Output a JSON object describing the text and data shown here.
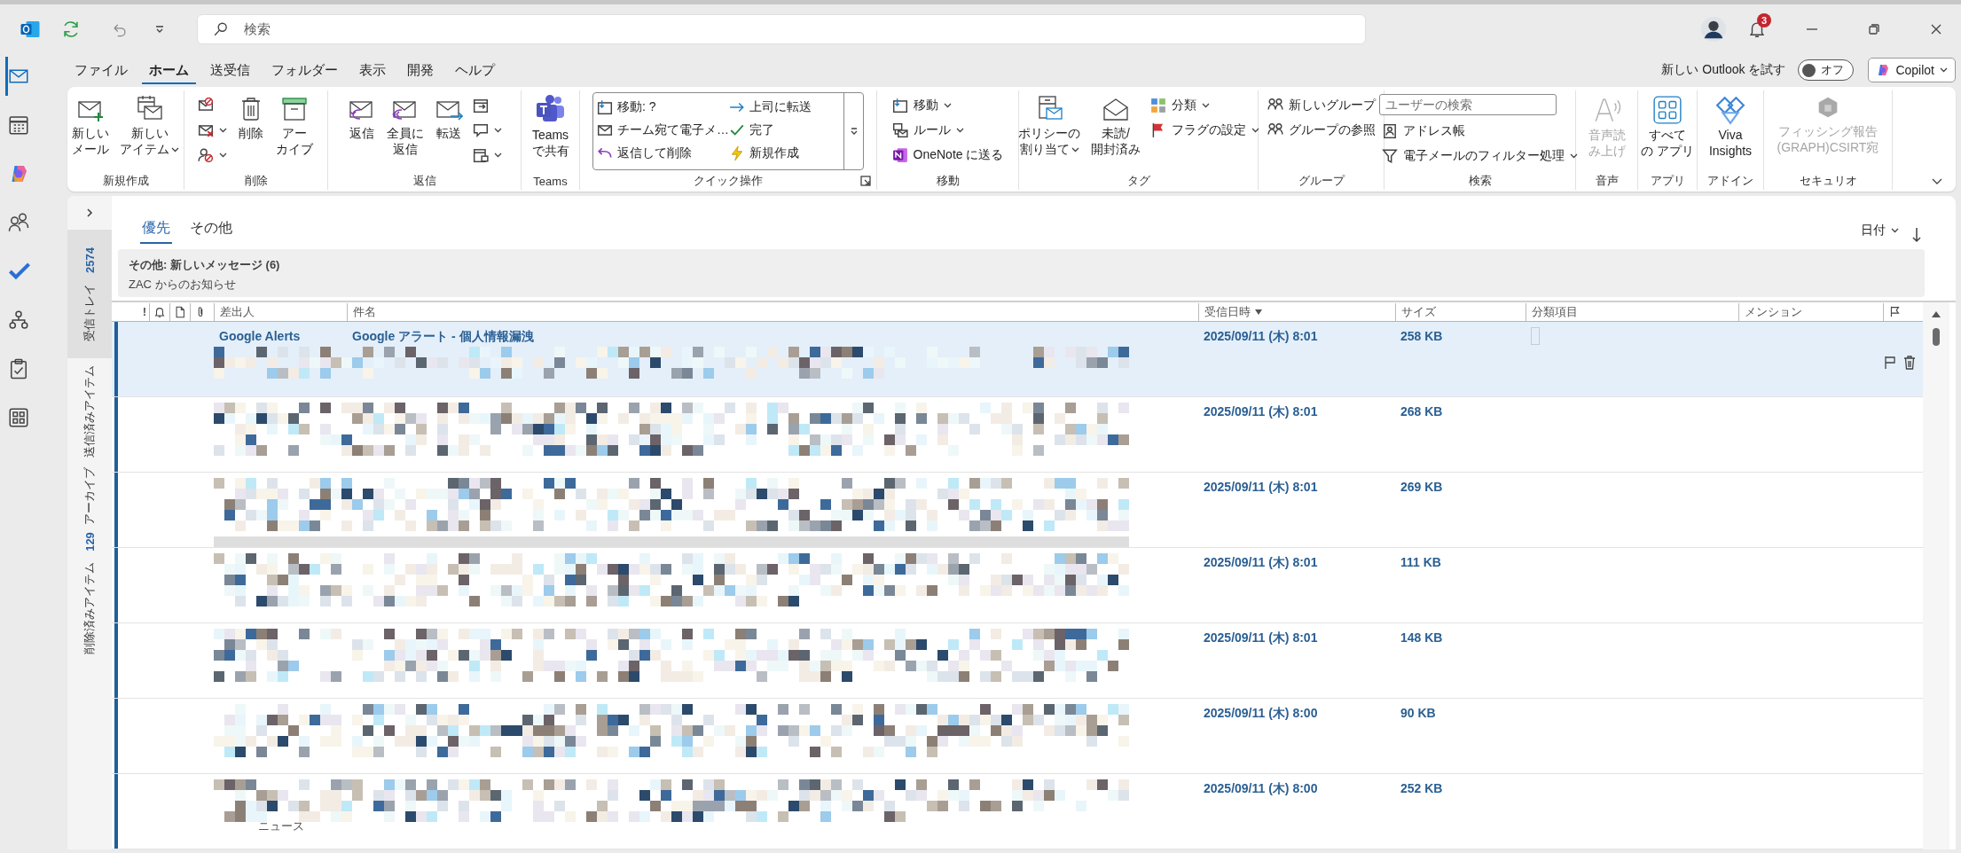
{
  "title_bar": {
    "search_placeholder": "検索",
    "notification_count": "3"
  },
  "nav_rail": [
    {
      "selected": true
    },
    {
      "selected": false
    },
    {
      "selected": false
    },
    {
      "selected": false
    },
    {
      "selected": false
    },
    {
      "selected": false
    },
    {
      "selected": false
    },
    {
      "selected": false
    }
  ],
  "menu_tabs": [
    {
      "label": "ファイル",
      "selected": false
    },
    {
      "label": "ホーム",
      "selected": true
    },
    {
      "label": "送受信",
      "selected": false
    },
    {
      "label": "フォルダー",
      "selected": false
    },
    {
      "label": "表示",
      "selected": false
    },
    {
      "label": "開発",
      "selected": false
    },
    {
      "label": "ヘルプ",
      "selected": false
    }
  ],
  "try_new_outlook": {
    "label": "新しい Outlook を試す",
    "on": false,
    "state_label": "オフ"
  },
  "copilot": {
    "label": "Copilot"
  },
  "ribbon": {
    "groups": [
      {
        "label": "新規作成",
        "columns": [
          {
            "kind": "large",
            "lines": [
              "新しい",
              "メール"
            ],
            "has_menu": false,
            "disabled": false
          },
          {
            "kind": "large",
            "lines": [
              "新しい",
              "アイテム"
            ],
            "has_menu": true,
            "disabled": false
          }
        ]
      },
      {
        "label": "削除",
        "columns": [
          {
            "kind": "stack",
            "items": [
              {
                "kind": "button",
                "has_menu": false
              },
              {
                "kind": "button",
                "has_menu": true
              },
              {
                "kind": "button",
                "has_menu": true
              }
            ]
          },
          {
            "kind": "large",
            "lines": [
              "削除"
            ],
            "has_menu": false,
            "disabled": false
          },
          {
            "kind": "large",
            "lines": [
              "アー",
              "カイブ"
            ],
            "has_menu": false,
            "disabled": false
          }
        ]
      },
      {
        "label": "返信",
        "columns": [
          {
            "kind": "large",
            "lines": [
              "返信"
            ],
            "has_menu": false,
            "disabled": false
          },
          {
            "kind": "large",
            "lines": [
              "全員に",
              "返信"
            ],
            "has_menu": false,
            "disabled": false
          },
          {
            "kind": "large",
            "lines": [
              "転送"
            ],
            "has_menu": false,
            "disabled": false
          },
          {
            "kind": "stack",
            "items": [
              {
                "kind": "button",
                "has_menu": false
              },
              {
                "kind": "button",
                "has_menu": true
              },
              {
                "kind": "button",
                "has_menu": true
              }
            ]
          }
        ]
      },
      {
        "label": "Teams",
        "columns": [
          {
            "kind": "large",
            "lines": [
              "Teams",
              "で共有"
            ],
            "has_menu": false,
            "disabled": false
          }
        ]
      },
      {
        "label": "クイック操作",
        "columns": [
          {
            "kind": "gallery",
            "items": [
              "移動: ?",
              "上司に転送",
              "チーム宛て電子メ…",
              "完了",
              "返信して削除",
              "新規作成"
            ]
          }
        ]
      },
      {
        "label": "移動",
        "columns": [
          {
            "kind": "stack",
            "items": [
              {
                "kind": "button",
                "label": "移動",
                "has_menu": true
              },
              {
                "kind": "button",
                "label": "ルール",
                "has_menu": true
              },
              {
                "kind": "button",
                "label": "OneNote に送る",
                "has_menu": false
              }
            ]
          }
        ]
      },
      {
        "label": "タグ",
        "columns": [
          {
            "kind": "large",
            "lines": [
              "ポリシーの",
              "割り当て"
            ],
            "has_menu": true,
            "disabled": false
          },
          {
            "kind": "large",
            "lines": [
              "未読/",
              "開封済み"
            ],
            "has_menu": false,
            "disabled": false
          },
          {
            "kind": "stack",
            "items": [
              {
                "kind": "button",
                "label": "分類",
                "has_menu": true
              },
              {
                "kind": "button",
                "label": "フラグの設定",
                "has_menu": true
              }
            ]
          }
        ]
      },
      {
        "label": "グループ",
        "columns": [
          {
            "kind": "stack",
            "items": [
              {
                "kind": "button",
                "label": "新しいグループ",
                "has_menu": false
              },
              {
                "kind": "button",
                "label": "グループの参照",
                "has_menu": false
              }
            ]
          }
        ]
      },
      {
        "label": "検索",
        "columns": [
          {
            "kind": "stack",
            "items": [
              {
                "kind": "field",
                "placeholder": "ユーザーの検索"
              },
              {
                "kind": "button",
                "label": "アドレス帳",
                "has_menu": false
              },
              {
                "kind": "button",
                "label": "電子メールのフィルター処理",
                "has_menu": true
              }
            ]
          }
        ]
      },
      {
        "label": "音声",
        "columns": [
          {
            "kind": "large",
            "lines": [
              "音声読",
              "み上げ"
            ],
            "has_menu": false,
            "disabled": true
          }
        ]
      },
      {
        "label": "アプリ",
        "columns": [
          {
            "kind": "large",
            "lines": [
              "すべて",
              "の アプリ"
            ],
            "has_menu": false,
            "disabled": false
          }
        ]
      },
      {
        "label": "アドイン",
        "columns": [
          {
            "kind": "large",
            "lines": [
              "Viva",
              "Insights"
            ],
            "has_menu": false,
            "disabled": false
          }
        ]
      },
      {
        "label": "セキュリオ",
        "columns": [
          {
            "kind": "large",
            "lines": [
              "フィッシング報告",
              "(GRAPH)CSIRT宛"
            ],
            "has_menu": false,
            "disabled": true
          }
        ]
      }
    ]
  },
  "folders": [
    {
      "label": "受信トレイ",
      "count": "2574",
      "selected": true
    },
    {
      "label": "送信済みアイテム",
      "selected": false
    },
    {
      "label": "アーカイブ",
      "selected": false
    },
    {
      "label": "削除済みアイテム",
      "count": "129",
      "selected": false
    }
  ],
  "mail_list": {
    "tabs": [
      {
        "label": "優先",
        "selected": true
      },
      {
        "label": "その他",
        "selected": false
      }
    ],
    "sort": {
      "label": "日付"
    },
    "notice": {
      "title": "その他: 新しいメッセージ (6)",
      "text": "ZAC からのお知らせ"
    },
    "importance_header": "!",
    "columns": [
      {
        "label": "差出人",
        "sorted": false
      },
      {
        "label": "件名",
        "sorted": false
      },
      {
        "label": "受信日時",
        "sorted": true
      },
      {
        "label": "サイズ",
        "sorted": false
      },
      {
        "label": "分類項目",
        "sorted": false
      },
      {
        "label": "メンション",
        "sorted": false
      }
    ],
    "rows": [
      {
        "sender": "Google Alerts",
        "subject": "Google アラート - 個人情報漏洩",
        "received": "2025/09/11 (木) 8:01",
        "size": "258 KB",
        "unread": true,
        "selected": true
      },
      {
        "received": "2025/09/11 (木) 8:01",
        "size": "268 KB",
        "unread": true,
        "selected": false
      },
      {
        "received": "2025/09/11 (木) 8:01",
        "size": "269 KB",
        "unread": true,
        "selected": false
      },
      {
        "received": "2025/09/11 (木) 8:01",
        "size": "111 KB",
        "unread": true,
        "selected": false
      },
      {
        "received": "2025/09/11 (木) 8:01",
        "size": "148 KB",
        "unread": true,
        "selected": false
      },
      {
        "received": "2025/09/11 (木) 8:00",
        "size": "90 KB",
        "unread": true,
        "selected": false
      },
      {
        "received": "2025/09/11 (木) 8:00",
        "size": "252 KB",
        "unread": true,
        "selected": false,
        "snippet": "ニュース"
      }
    ]
  }
}
